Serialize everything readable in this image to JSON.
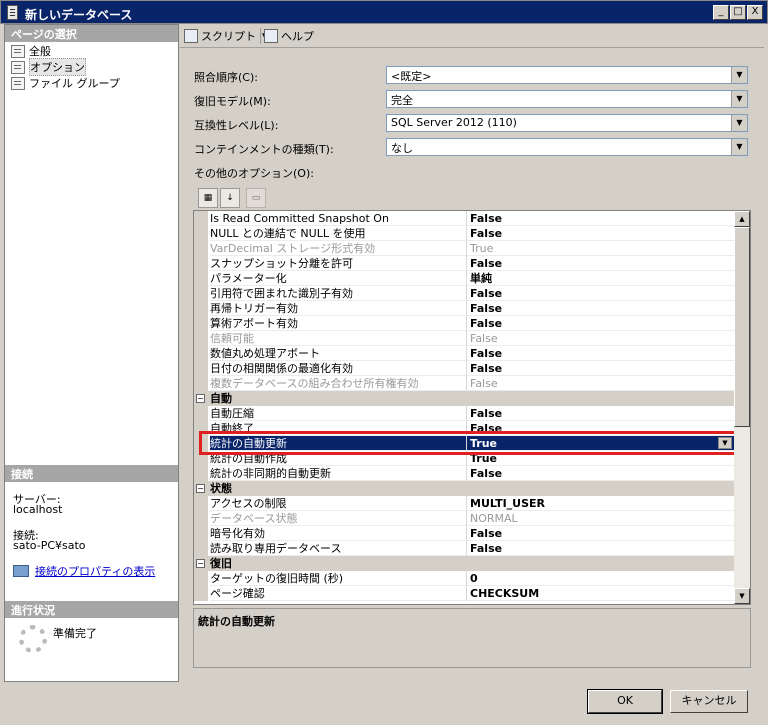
{
  "window": {
    "title": "新しいデータベース",
    "buttons": [
      "_",
      "□",
      "X"
    ]
  },
  "left": {
    "pages_header": "ページの選択",
    "pages": [
      {
        "label": "全般",
        "selected": false
      },
      {
        "label": "オプション",
        "selected": true
      },
      {
        "label": "ファイル グループ",
        "selected": false
      }
    ],
    "connection_header": "接続",
    "server_label": "サーバー:",
    "server_value": "localhost",
    "conn_label": "接続:",
    "conn_value": "sato-PC¥sato",
    "conn_link": "接続のプロパティの表示",
    "progress_header": "進行状況",
    "progress_status": "準備完了"
  },
  "toolbar": {
    "script": "スクリプト",
    "script_arrow": "▾",
    "help": "ヘルプ"
  },
  "form": {
    "collation": {
      "label": "照合順序(C):",
      "value": "<既定>"
    },
    "recovery": {
      "label": "復旧モデル(M):",
      "value": "完全"
    },
    "compat": {
      "label": "互換性レベル(L):",
      "value": "SQL Server 2012 (110)"
    },
    "containment": {
      "label": "コンテインメントの種類(T):",
      "value": "なし"
    },
    "other_label": "その他のオプション(O):"
  },
  "grid": {
    "rows": [
      {
        "name": "Is Read Committed Snapshot On",
        "value": "False",
        "kind": "item"
      },
      {
        "name": "NULL との連結で NULL を使用",
        "value": "False",
        "kind": "item"
      },
      {
        "name": "VarDecimal ストレージ形式有効",
        "value": "True",
        "kind": "disabled"
      },
      {
        "name": "スナップショット分離を許可",
        "value": "False",
        "kind": "item"
      },
      {
        "name": "パラメーター化",
        "value": "単純",
        "kind": "item"
      },
      {
        "name": "引用符で囲まれた識別子有効",
        "value": "False",
        "kind": "item"
      },
      {
        "name": "再帰トリガー有効",
        "value": "False",
        "kind": "item"
      },
      {
        "name": "算術アボート有効",
        "value": "False",
        "kind": "item"
      },
      {
        "name": "信頼可能",
        "value": "False",
        "kind": "disabled"
      },
      {
        "name": "数値丸め処理アボート",
        "value": "False",
        "kind": "item"
      },
      {
        "name": "日付の相関関係の最適化有効",
        "value": "False",
        "kind": "item"
      },
      {
        "name": "複数データベースの組み合わせ所有権有効",
        "value": "False",
        "kind": "disabled"
      },
      {
        "name": "自動",
        "value": "",
        "kind": "cat"
      },
      {
        "name": "自動圧縮",
        "value": "False",
        "kind": "item"
      },
      {
        "name": "自動終了",
        "value": "False",
        "kind": "item"
      },
      {
        "name": "統計の自動更新",
        "value": "True",
        "kind": "sel"
      },
      {
        "name": "統計の自動作成",
        "value": "True",
        "kind": "item"
      },
      {
        "name": "統計の非同期的自動更新",
        "value": "False",
        "kind": "item"
      },
      {
        "name": "状態",
        "value": "",
        "kind": "cat"
      },
      {
        "name": "アクセスの制限",
        "value": "MULTI_USER",
        "kind": "item"
      },
      {
        "name": "データベース状態",
        "value": "NORMAL",
        "kind": "disabled"
      },
      {
        "name": "暗号化有効",
        "value": "False",
        "kind": "item"
      },
      {
        "name": "読み取り専用データベース",
        "value": "False",
        "kind": "item"
      },
      {
        "name": "復旧",
        "value": "",
        "kind": "cat"
      },
      {
        "name": "ターゲットの復旧時間 (秒)",
        "value": "0",
        "kind": "item"
      },
      {
        "name": "ページ確認",
        "value": "CHECKSUM",
        "kind": "item"
      }
    ]
  },
  "description": {
    "title": "統計の自動更新"
  },
  "buttons": {
    "ok": "OK",
    "cancel": "キャンセル"
  }
}
